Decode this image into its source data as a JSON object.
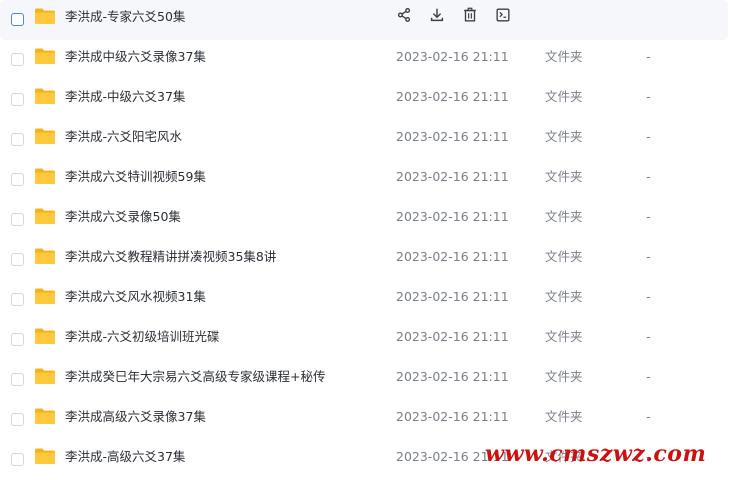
{
  "colors": {
    "folder": "#ffc83d",
    "folder_dark": "#f2b418",
    "hover_bg": "#f6f7fb",
    "accent": "#5b7cff",
    "watermark": "#cc1111"
  },
  "actions": [
    {
      "name": "share-icon",
      "label": "share"
    },
    {
      "name": "download-icon",
      "label": "download"
    },
    {
      "name": "delete-icon",
      "label": "delete"
    },
    {
      "name": "more-icon",
      "label": "more"
    }
  ],
  "files": [
    {
      "name": "李洪成-专家六爻50集",
      "date": "",
      "type": "",
      "size": "",
      "hovered": true
    },
    {
      "name": "李洪成中级六爻录像37集",
      "date": "2023-02-16 21:11",
      "type": "文件夹",
      "size": "-"
    },
    {
      "name": "李洪成-中级六爻37集",
      "date": "2023-02-16 21:11",
      "type": "文件夹",
      "size": "-"
    },
    {
      "name": "李洪成-六爻阳宅风水",
      "date": "2023-02-16 21:11",
      "type": "文件夹",
      "size": "-"
    },
    {
      "name": "李洪成六爻特训视频59集",
      "date": "2023-02-16 21:11",
      "type": "文件夹",
      "size": "-"
    },
    {
      "name": "李洪成六爻录像50集",
      "date": "2023-02-16 21:11",
      "type": "文件夹",
      "size": "-"
    },
    {
      "name": "李洪成六爻教程精讲拼凑视频35集8讲",
      "date": "2023-02-16 21:11",
      "type": "文件夹",
      "size": "-"
    },
    {
      "name": "李洪成六爻风水视频31集",
      "date": "2023-02-16 21:11",
      "type": "文件夹",
      "size": "-"
    },
    {
      "name": "李洪成-六爻初级培训班光碟",
      "date": "2023-02-16 21:11",
      "type": "文件夹",
      "size": "-"
    },
    {
      "name": "李洪成癸巳年大宗易六爻高级专家级课程+秘传",
      "date": "2023-02-16 21:11",
      "type": "文件夹",
      "size": "-"
    },
    {
      "name": "李洪成高级六爻录像37集",
      "date": "2023-02-16 21:11",
      "type": "文件夹",
      "size": "-"
    },
    {
      "name": "李洪成-高级六爻37集",
      "date": "2023-02-16 21:11",
      "type": "文件夹",
      "size": "-"
    }
  ],
  "watermark": "www.cmszwz.com"
}
